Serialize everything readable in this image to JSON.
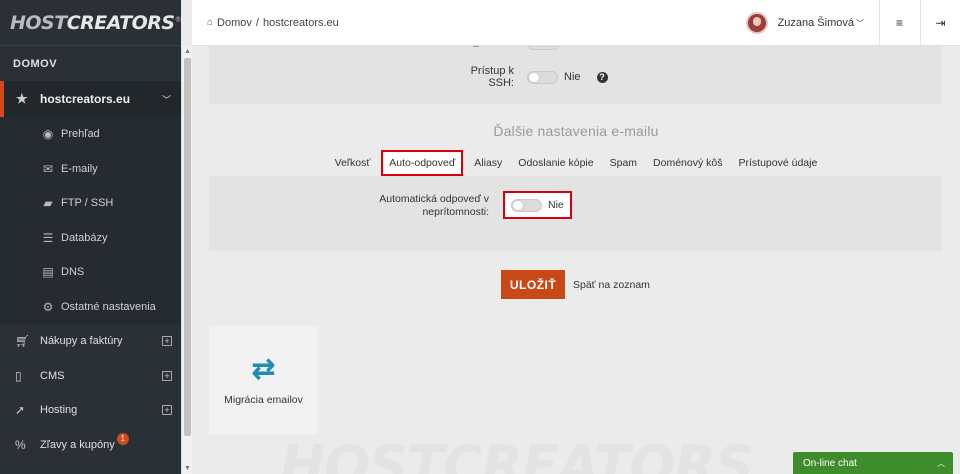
{
  "logo": {
    "part1": "HOST",
    "part2": "CREATORS",
    "reg": "®"
  },
  "sidebar": {
    "section_title": "DOMOV",
    "domain": "hostcreators.eu",
    "sub_items": [
      {
        "label": "Prehľad",
        "icon": "globe-icon"
      },
      {
        "label": "E-maily",
        "icon": "envelope-icon"
      },
      {
        "label": "FTP / SSH",
        "icon": "folder-icon"
      },
      {
        "label": "Databázy",
        "icon": "database-icon"
      },
      {
        "label": "DNS",
        "icon": "server-icon"
      },
      {
        "label": "Ostatné nastavenia",
        "icon": "gear-icon"
      }
    ],
    "main_items": [
      {
        "label": "Nákupy a faktúry",
        "icon": "cart-icon"
      },
      {
        "label": "CMS",
        "icon": "document-icon"
      },
      {
        "label": "Hosting",
        "icon": "rocket-icon"
      },
      {
        "label": "Zľavy a kupóny",
        "icon": "percent-icon",
        "badge": "1"
      }
    ]
  },
  "header": {
    "breadcrumb_home": "Domov",
    "breadcrumb_sep": "/",
    "breadcrumb_current": "hostcreators.eu",
    "user_name": "Zuzana Šimová"
  },
  "ssh": {
    "label": "Prístup k SSH:",
    "value": "Nie"
  },
  "email_settings": {
    "title": "Ďalšie nastavenia e-mailu",
    "tabs": [
      "Veľkosť",
      "Auto-odpoveď",
      "Aliasy",
      "Odoslanie kópie",
      "Spam",
      "Doménový kôš",
      "Prístupové údaje"
    ],
    "active_tab": 1,
    "auto_reply_label_1": "Automatická odpoveď v",
    "auto_reply_label_2": "neprítomnosti:",
    "auto_reply_value": "Nie"
  },
  "actions": {
    "save": "ULOŽIŤ",
    "back": "Späť na zoznam"
  },
  "migration": {
    "label": "Migrácia emailov"
  },
  "watermark": "HOSTCREATORS",
  "chat": {
    "label": "On-line chat"
  },
  "colors": {
    "accent": "#c84817",
    "highlight": "#d6000f",
    "chat": "#3f8c2d",
    "migration_icon": "#1e8fb0"
  }
}
